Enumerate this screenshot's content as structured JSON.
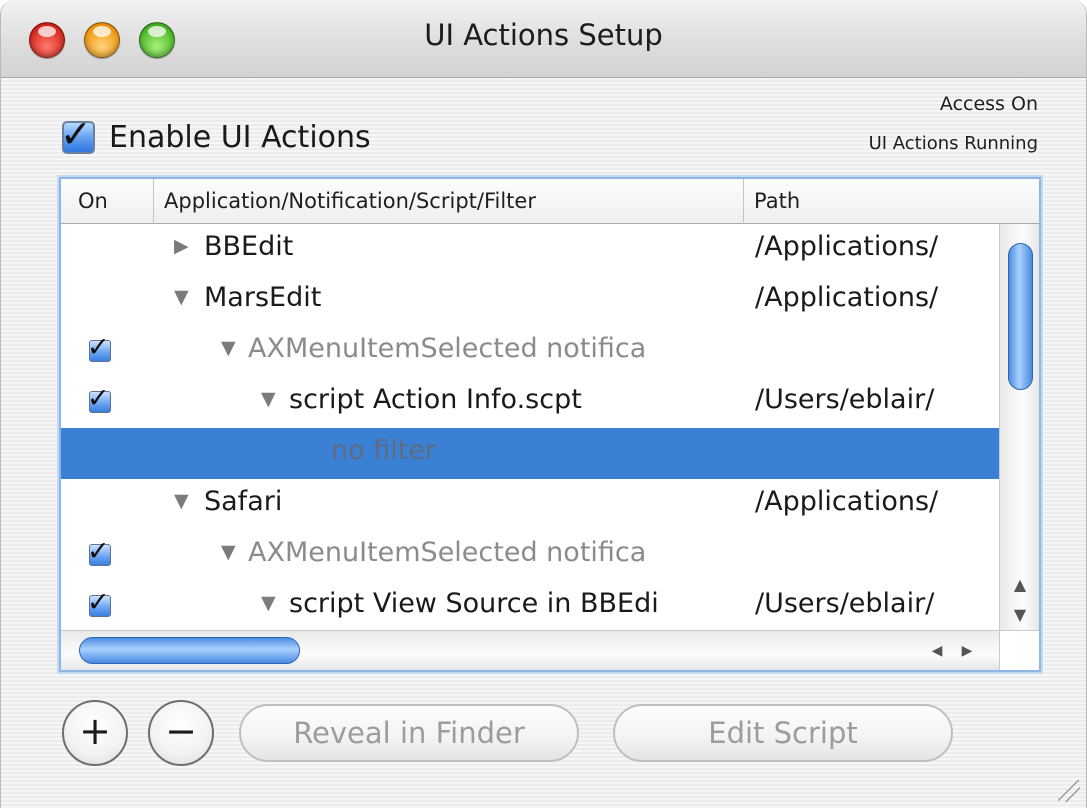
{
  "window": {
    "title": "UI Actions Setup"
  },
  "status": {
    "access": "Access On",
    "running": "UI Actions Running"
  },
  "enable": {
    "label": "Enable UI Actions",
    "checked": true,
    "check_glyph": "✓"
  },
  "table": {
    "columns": [
      "On",
      "Application/Notification/Script/Filter",
      "Path"
    ],
    "rows": [
      {
        "on": "",
        "disclosure": "▶",
        "label": "BBEdit",
        "path": "/Applications/",
        "dim": false
      },
      {
        "on": "",
        "disclosure": "▼",
        "label": "MarsEdit",
        "path": "/Applications/",
        "dim": false
      },
      {
        "on": "✓",
        "disclosure": "▼",
        "label": "AXMenuItemSelected notifica",
        "path": "",
        "dim": true
      },
      {
        "on": "✓",
        "disclosure": "▼",
        "label": "script Action Info.scpt",
        "path": "/Users/eblair/",
        "dim": false
      },
      {
        "on": "",
        "disclosure": "",
        "label": "no filter",
        "path": "",
        "dim": false,
        "selected": true
      },
      {
        "on": "",
        "disclosure": "▼",
        "label": "Safari",
        "path": "/Applications/",
        "dim": false
      },
      {
        "on": "✓",
        "disclosure": "▼",
        "label": "AXMenuItemSelected notifica",
        "path": "",
        "dim": true
      },
      {
        "on": "✓",
        "disclosure": "▼",
        "label": "script View Source in BBEdi",
        "path": "/Users/eblair/",
        "dim": false
      }
    ]
  },
  "scroll": {
    "up": "▲",
    "down": "▼",
    "left": "◀",
    "right": "▶"
  },
  "buttons": {
    "add": "+",
    "remove": "−",
    "reveal": "Reveal in Finder",
    "edit": "Edit Script"
  },
  "colors": {
    "selection": "#3a81d6",
    "accent": "#5e9cf0"
  }
}
